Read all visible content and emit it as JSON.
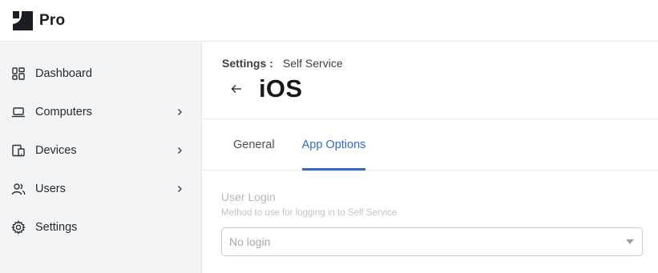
{
  "app": {
    "name": "Pro",
    "logo_icon": "jamf-logo-icon"
  },
  "sidebar": {
    "items": [
      {
        "label": "Dashboard",
        "icon": "dashboard-grid-icon",
        "has_chevron": false
      },
      {
        "label": "Computers",
        "icon": "laptop-icon",
        "has_chevron": true
      },
      {
        "label": "Devices",
        "icon": "devices-icon",
        "has_chevron": true
      },
      {
        "label": "Users",
        "icon": "users-icon",
        "has_chevron": true
      },
      {
        "label": "Settings",
        "icon": "gear-icon",
        "has_chevron": false
      }
    ]
  },
  "header": {
    "breadcrumb": {
      "parent": "Settings",
      "separator": ":",
      "current": "Self Service"
    },
    "title": "iOS"
  },
  "tabs": [
    {
      "label": "General",
      "active": false
    },
    {
      "label": "App Options",
      "active": true
    }
  ],
  "form": {
    "user_login": {
      "label": "User Login",
      "help": "Method to use for logging in to Self Service",
      "value": "No login"
    }
  },
  "colors": {
    "accent": "#2f6bcf",
    "sidebar_bg": "#f3f4f6",
    "border": "#e3e6ea"
  }
}
